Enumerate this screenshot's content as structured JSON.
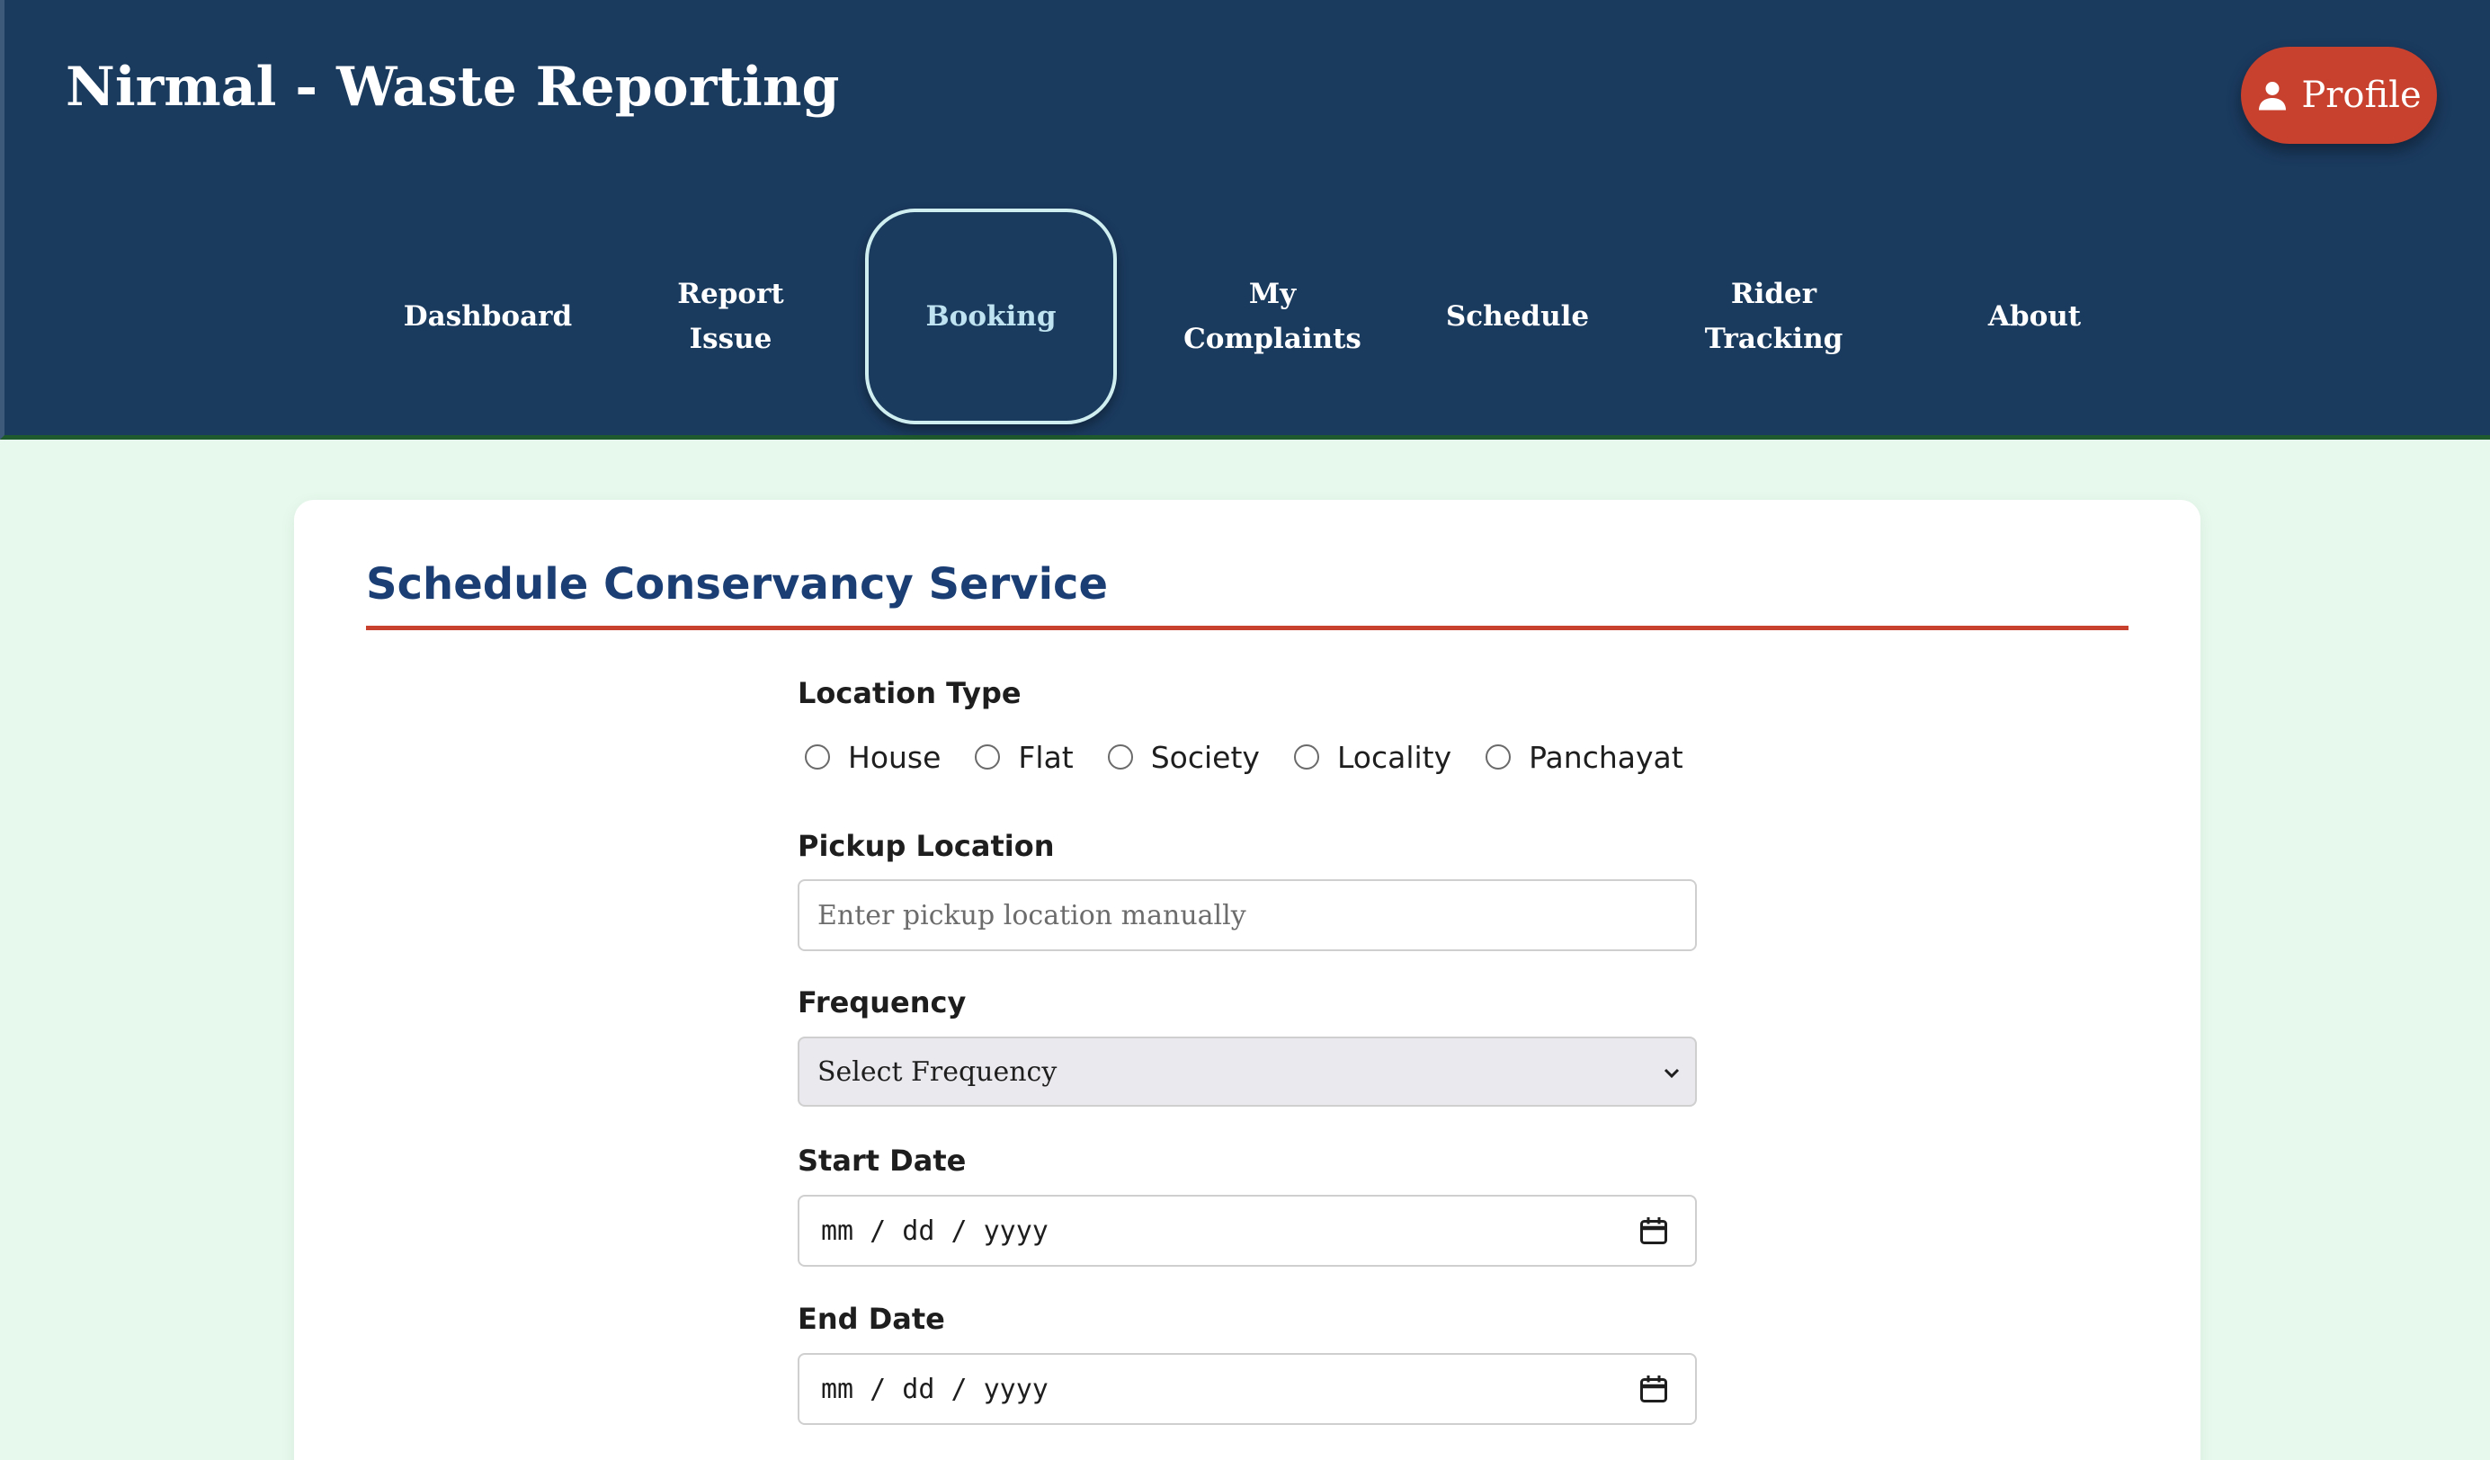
{
  "app": {
    "title": "Nirmal - Waste Reporting"
  },
  "header": {
    "profile_label": "Profile"
  },
  "nav": {
    "dashboard": "Dashboard",
    "report_issue_line1": "Report",
    "report_issue_line2": "Issue",
    "booking": "Booking",
    "my_complaints_line1": "My",
    "my_complaints_line2": "Complaints",
    "schedule": "Schedule",
    "rider_tracking_line1": "Rider",
    "rider_tracking_line2": "Tracking",
    "about": "About",
    "active": "Booking"
  },
  "form": {
    "title": "Schedule Conservancy Service",
    "location_type_label": "Location Type",
    "location_types": [
      "House",
      "Flat",
      "Society",
      "Locality",
      "Panchayat"
    ],
    "pickup_location_label": "Pickup Location",
    "pickup_location_placeholder": "Enter pickup location manually",
    "frequency_label": "Frequency",
    "frequency_value": "Select Frequency",
    "start_date_label": "Start Date",
    "start_date_value": "mm / dd / yyyy",
    "end_date_label": "End Date",
    "end_date_value": "mm / dd / yyyy"
  },
  "colors": {
    "header_bg": "#1a3a5e",
    "accent": "#c8402e",
    "page_bg": "#e6f9ec",
    "title_blue": "#1b3f74"
  },
  "icons": {
    "profile": "person-icon",
    "select": "chevron-down-icon",
    "date": "calendar-icon"
  }
}
